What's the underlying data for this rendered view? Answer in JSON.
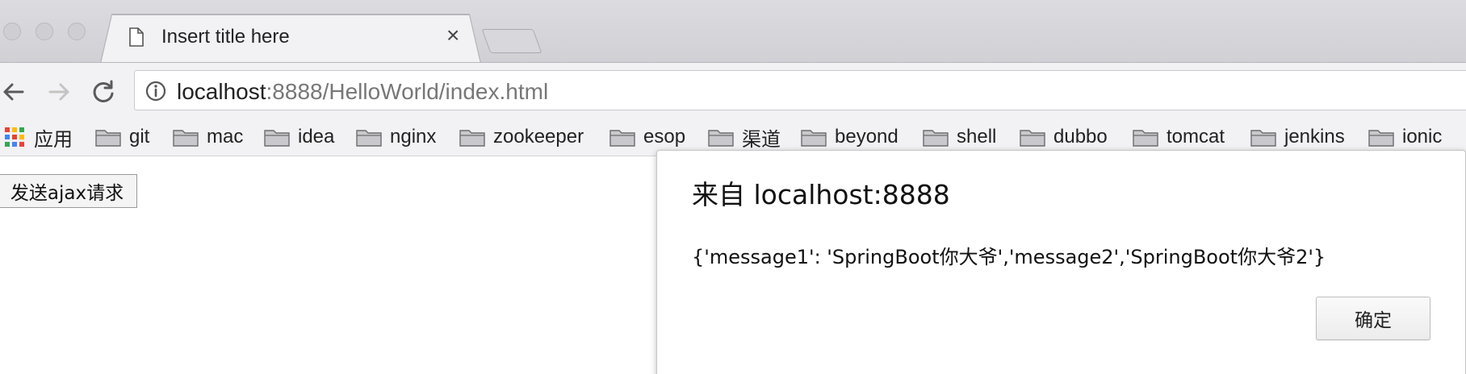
{
  "browser": {
    "tab": {
      "title": "Insert title here",
      "close_glyph": "×",
      "page_icon": "page-icon"
    },
    "address_bar": {
      "host": "localhost",
      "rest": ":8888/HelloWorld/index.html",
      "info_icon": "info-icon"
    },
    "nav": {
      "back_icon": "back-arrow-icon",
      "forward_icon": "forward-arrow-icon",
      "reload_icon": "reload-icon"
    },
    "bookmarks": [
      {
        "label": "应用",
        "icon": "apps-icon"
      },
      {
        "label": "git",
        "icon": "folder-icon"
      },
      {
        "label": "mac",
        "icon": "folder-icon"
      },
      {
        "label": "idea",
        "icon": "folder-icon"
      },
      {
        "label": "nginx",
        "icon": "folder-icon"
      },
      {
        "label": "zookeeper",
        "icon": "folder-icon"
      },
      {
        "label": "esop",
        "icon": "folder-icon"
      },
      {
        "label": "渠道",
        "icon": "folder-icon"
      },
      {
        "label": "beyond",
        "icon": "folder-icon"
      },
      {
        "label": "shell",
        "icon": "folder-icon"
      },
      {
        "label": "dubbo",
        "icon": "folder-icon"
      },
      {
        "label": "tomcat",
        "icon": "folder-icon"
      },
      {
        "label": "jenkins",
        "icon": "folder-icon"
      },
      {
        "label": "ionic",
        "icon": "folder-icon"
      }
    ]
  },
  "page": {
    "ajax_button_label": "发送ajax请求"
  },
  "dialog": {
    "title": "来自 localhost:8888",
    "message": "{'message1': 'SpringBoot你大爷','message2','SpringBoot你大爷2'}",
    "ok_label": "确定"
  },
  "colors": {
    "chrome_bg": "#f2f2f4",
    "titlebar_bg": "#d3d3d8",
    "folder_fill": "#c8c8cc",
    "apps_colors": [
      "#e94235",
      "#fbbc04",
      "#34a853",
      "#4285f4",
      "#e94235",
      "#fbbc04",
      "#34a853",
      "#4285f4",
      "#e94235"
    ]
  }
}
